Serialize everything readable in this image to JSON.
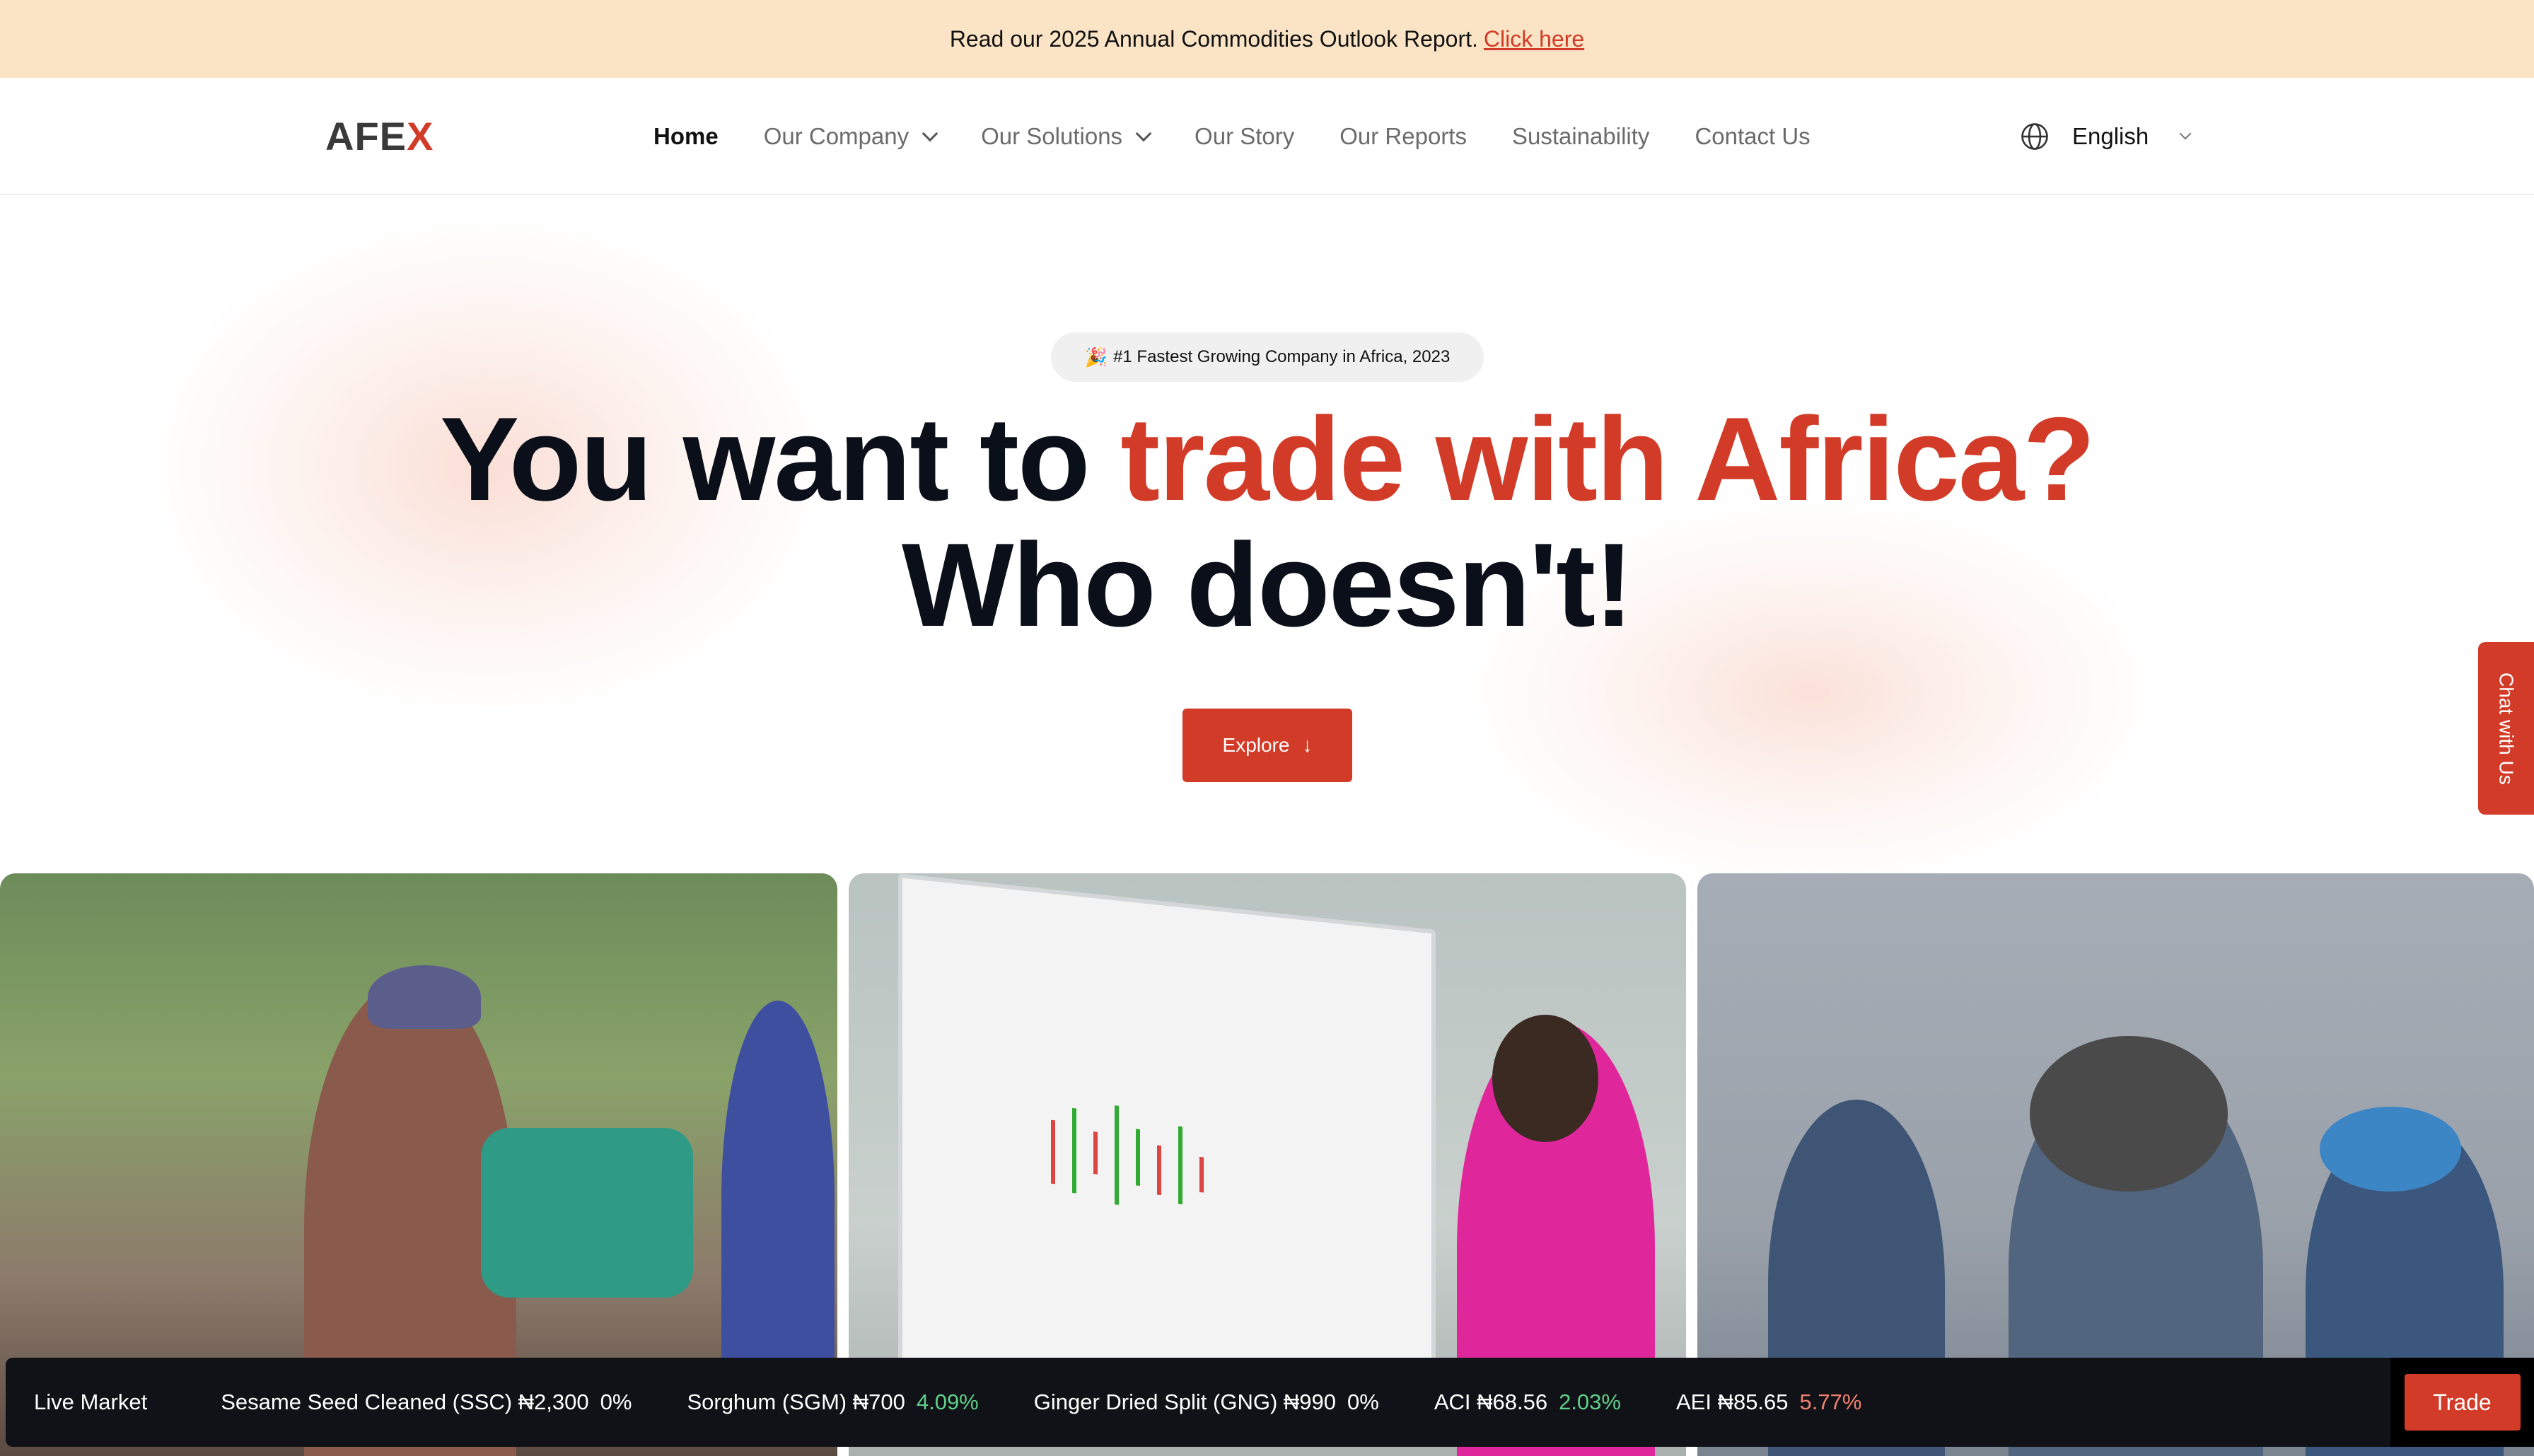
{
  "announcement": {
    "text": "Read our 2025 Annual Commodities Outlook Report.",
    "link_text": "Click here"
  },
  "nav": {
    "logo_main": "AFE",
    "logo_accent": "X",
    "items": [
      {
        "label": "Home",
        "active": true,
        "dropdown": false
      },
      {
        "label": "Our Company",
        "active": false,
        "dropdown": true
      },
      {
        "label": "Our Solutions",
        "active": false,
        "dropdown": true
      },
      {
        "label": "Our Story",
        "active": false,
        "dropdown": false
      },
      {
        "label": "Our Reports",
        "active": false,
        "dropdown": false
      },
      {
        "label": "Sustainability",
        "active": false,
        "dropdown": false
      },
      {
        "label": "Contact Us",
        "active": false,
        "dropdown": false
      }
    ],
    "language": "English"
  },
  "hero": {
    "badge_icon": "🎉",
    "badge_text": "#1 Fastest Growing Company in Africa, 2023",
    "headline_part1": "You want to ",
    "headline_highlight": "trade with Africa?",
    "headline_line2": "Who doesn't!",
    "explore_label": "Explore",
    "explore_icon": "↓"
  },
  "chat_tab": "Chat with Us",
  "ticker": {
    "title": "Live Market",
    "items": [
      {
        "label": "Sesame Seed Cleaned (SSC) ₦2,300",
        "change": "0%",
        "trend": "zero"
      },
      {
        "label": "Sorghum (SGM) ₦700",
        "change": "4.09%",
        "trend": "up"
      },
      {
        "label": "Ginger Dried Split (GNG) ₦990",
        "change": "0%",
        "trend": "zero"
      },
      {
        "label": "ACI ₦68.56",
        "change": "2.03%",
        "trend": "up"
      },
      {
        "label": "AEI ₦85.65",
        "change": "5.77%",
        "trend": "down"
      }
    ],
    "trade_label": "Trade"
  },
  "colors": {
    "accent": "#d23b27",
    "announce_bg": "#fbe4c6",
    "ticker_bg": "#111217",
    "up": "#5fcf8a",
    "down": "#f08070"
  }
}
